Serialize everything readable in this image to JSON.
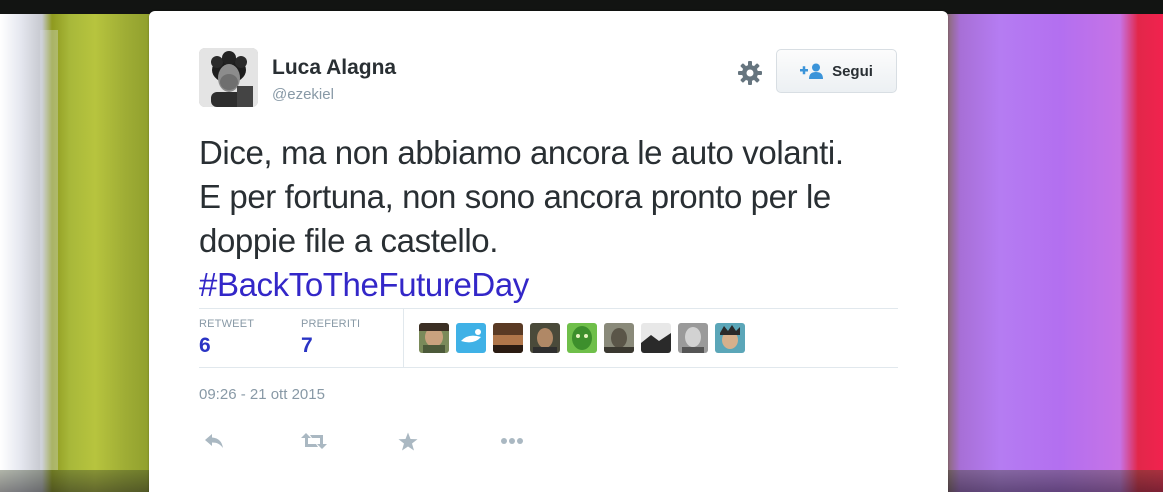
{
  "tweet": {
    "author_name": "Luca Alagna",
    "author_handle": "@ezekiel",
    "text_lines": [
      "Dice, ma non abbiamo ancora le auto volanti.",
      "E per fortuna, non sono ancora pronto per le",
      "doppie file a castello."
    ],
    "hashtag": "#BackToTheFutureDay",
    "timestamp": "09:26 - 21 ott 2015"
  },
  "header": {
    "follow_label": "Segui",
    "settings_icon": "gear-icon",
    "follow_icon": "add-user-icon"
  },
  "stats": {
    "retweet_label": "RETWEET",
    "retweet_count": "6",
    "favorites_label": "PREFERITI",
    "favorites_count": "7",
    "favoriter_avatar_count": 9
  },
  "actions": [
    {
      "name": "reply",
      "icon": "reply-icon"
    },
    {
      "name": "retweet",
      "icon": "retweet-icon"
    },
    {
      "name": "favorite",
      "icon": "star-icon"
    },
    {
      "name": "more",
      "icon": "more-icon"
    }
  ],
  "colors": {
    "text": "#292f33",
    "muted": "#8899a6",
    "hashtag": "#3327c8",
    "counts": "#2a34c4",
    "border": "#e1e8ed",
    "icons": "#aab8c2"
  }
}
